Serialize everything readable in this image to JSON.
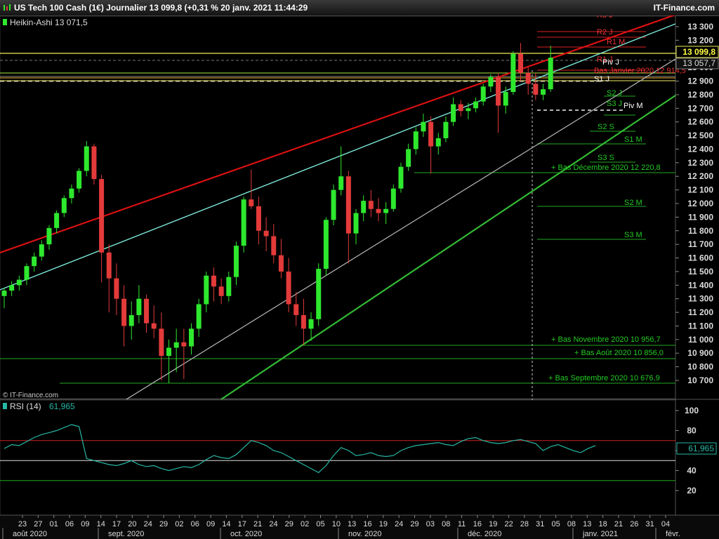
{
  "header": {
    "title": "US Tech 100 Cash (1€) Journalier 13 099,8 (+0,31 % 20 janv. 2021 11:44:29",
    "brand": "IT-Finance.com"
  },
  "legend": {
    "main": "Heikin-Ashi 13 071,5",
    "rsi_label": "RSI (14)",
    "rsi_value": "61,965"
  },
  "watermark": "© IT-Finance.com",
  "price_badges": {
    "last": "13 099,8",
    "second": "13 057,7",
    "rsi": "61,965"
  },
  "level_labels": {
    "r3j": "R3 J",
    "r2j": "R2 J",
    "r1m": "R1 M",
    "r1j": "R1 J",
    "pivj": "Piv J",
    "bas_jan": "Bas Janvier 2020 12 914,5",
    "s1j": "S1 J",
    "s2j": "S2 J",
    "s3j": "S3 J",
    "pivm": "Piv M",
    "s2s": "S2 S",
    "s1m": "S1 M",
    "s3s": "S3 S",
    "bas_dec": "+ Bas Décembre 2020 12 220,8",
    "s2m": "S2 M",
    "s3m": "S3 M",
    "bas_nov": "+ Bas Novembre 2020 10 956,7",
    "bas_aout": "+ Bas Août 2020 10 856,0",
    "bas_sept": "+ Bas Septembre 2020 10 676,9"
  },
  "colors": {
    "up": "#2ee82e",
    "down": "#e33a3a",
    "rsi_line": "#26b8a4",
    "red_trend": "#dd1111",
    "cyan_trend": "#7de8d8",
    "green_trend": "#33bb33",
    "white_trend": "#bbbbbb",
    "yellow": "#eeee55"
  },
  "chart_data": [
    {
      "type": "candlestick",
      "style": "Heikin-Ashi",
      "instrument": "US Tech 100 Cash (1€)",
      "period": "Journalier",
      "ylim": [
        10600,
        13400
      ],
      "y_ticks": [
        10700,
        10800,
        10900,
        11000,
        11100,
        11200,
        11300,
        11400,
        11500,
        11600,
        11700,
        11800,
        11900,
        12000,
        12100,
        12200,
        12300,
        12400,
        12500,
        12600,
        12700,
        12800,
        12900,
        13000,
        13100,
        13200,
        13300
      ],
      "y_tick_labels": [
        "10 700",
        "10 800",
        "10 900",
        "11 000",
        "11 100",
        "11 200",
        "11 300",
        "11 400",
        "11 500",
        "11 600",
        "11 700",
        "11 800",
        "11 900",
        "12 000",
        "12 100",
        "12 200",
        "12 300",
        "12 400",
        "12 500",
        "12 600",
        "12 700",
        "12 800",
        "12 900",
        "13 000",
        "13 100",
        "13 200",
        "13 300"
      ],
      "x_day_ticks": [
        "23",
        "27",
        "01",
        "06",
        "09",
        "14",
        "17",
        "20",
        "24",
        "29",
        "02",
        "06",
        "09",
        "14",
        "17",
        "21",
        "24",
        "29",
        "02",
        "05",
        "10",
        "13",
        "16",
        "19",
        "24",
        "29",
        "03",
        "08",
        "11",
        "16",
        "19",
        "22",
        "28",
        "31",
        "05",
        "08",
        "13",
        "18",
        "21",
        "26",
        "31",
        "04"
      ],
      "x_month_labels": [
        "août 2020",
        "sept. 2020",
        "oct. 2020",
        "nov. 2020",
        "déc. 2020",
        "janv. 2021",
        "févr."
      ],
      "candles": [
        {
          "o": 11320,
          "h": 11380,
          "l": 11230,
          "c": 11360
        },
        {
          "o": 11360,
          "h": 11430,
          "l": 11320,
          "c": 11400
        },
        {
          "o": 11400,
          "h": 11470,
          "l": 11360,
          "c": 11440
        },
        {
          "o": 11440,
          "h": 11560,
          "l": 11400,
          "c": 11540
        },
        {
          "o": 11540,
          "h": 11640,
          "l": 11500,
          "c": 11610
        },
        {
          "o": 11610,
          "h": 11730,
          "l": 11580,
          "c": 11700
        },
        {
          "o": 11700,
          "h": 11840,
          "l": 11660,
          "c": 11820
        },
        {
          "o": 11820,
          "h": 11950,
          "l": 11780,
          "c": 11930
        },
        {
          "o": 11930,
          "h": 12060,
          "l": 11900,
          "c": 12040
        },
        {
          "o": 12040,
          "h": 12140,
          "l": 12000,
          "c": 12110
        },
        {
          "o": 12110,
          "h": 12260,
          "l": 12080,
          "c": 12240
        },
        {
          "o": 12240,
          "h": 12460,
          "l": 12200,
          "c": 12420
        },
        {
          "o": 12420,
          "h": 12440,
          "l": 12140,
          "c": 12180
        },
        {
          "o": 12180,
          "h": 12210,
          "l": 11420,
          "c": 11640
        },
        {
          "o": 11640,
          "h": 11700,
          "l": 11200,
          "c": 11450
        },
        {
          "o": 11450,
          "h": 11560,
          "l": 11180,
          "c": 11300
        },
        {
          "o": 11300,
          "h": 11400,
          "l": 10950,
          "c": 11100
        },
        {
          "o": 11100,
          "h": 11280,
          "l": 11000,
          "c": 11180
        },
        {
          "o": 11180,
          "h": 11400,
          "l": 11120,
          "c": 11300
        },
        {
          "o": 11300,
          "h": 11330,
          "l": 11050,
          "c": 11120
        },
        {
          "o": 11120,
          "h": 11250,
          "l": 11010,
          "c": 11080
        },
        {
          "o": 11080,
          "h": 11200,
          "l": 10700,
          "c": 10880
        },
        {
          "o": 10880,
          "h": 11000,
          "l": 10680,
          "c": 10940
        },
        {
          "o": 10940,
          "h": 11080,
          "l": 10760,
          "c": 10980
        },
        {
          "o": 10980,
          "h": 11080,
          "l": 10710,
          "c": 10950
        },
        {
          "o": 10950,
          "h": 11120,
          "l": 10890,
          "c": 11080
        },
        {
          "o": 11080,
          "h": 11300,
          "l": 11020,
          "c": 11260
        },
        {
          "o": 11260,
          "h": 11500,
          "l": 11200,
          "c": 11470
        },
        {
          "o": 11470,
          "h": 11530,
          "l": 11280,
          "c": 11390
        },
        {
          "o": 11390,
          "h": 11450,
          "l": 11260,
          "c": 11320
        },
        {
          "o": 11320,
          "h": 11500,
          "l": 11280,
          "c": 11460
        },
        {
          "o": 11460,
          "h": 11720,
          "l": 11400,
          "c": 11690
        },
        {
          "o": 11690,
          "h": 12050,
          "l": 11640,
          "c": 12030
        },
        {
          "o": 12030,
          "h": 12250,
          "l": 11960,
          "c": 11980
        },
        {
          "o": 11980,
          "h": 12050,
          "l": 11700,
          "c": 11800
        },
        {
          "o": 11800,
          "h": 11900,
          "l": 11650,
          "c": 11760
        },
        {
          "o": 11760,
          "h": 11850,
          "l": 11560,
          "c": 11620
        },
        {
          "o": 11620,
          "h": 11740,
          "l": 11450,
          "c": 11500
        },
        {
          "o": 11500,
          "h": 11600,
          "l": 11200,
          "c": 11260
        },
        {
          "o": 11260,
          "h": 11350,
          "l": 11100,
          "c": 11180
        },
        {
          "o": 11180,
          "h": 11300,
          "l": 10960,
          "c": 11080
        },
        {
          "o": 11080,
          "h": 11200,
          "l": 10990,
          "c": 11150
        },
        {
          "o": 11150,
          "h": 11560,
          "l": 11100,
          "c": 11520
        },
        {
          "o": 11520,
          "h": 11900,
          "l": 11470,
          "c": 11880
        },
        {
          "o": 11880,
          "h": 12140,
          "l": 11840,
          "c": 12100
        },
        {
          "o": 12100,
          "h": 12420,
          "l": 12060,
          "c": 12200
        },
        {
          "o": 12200,
          "h": 12240,
          "l": 11560,
          "c": 11780
        },
        {
          "o": 11780,
          "h": 11960,
          "l": 11700,
          "c": 11930
        },
        {
          "o": 11930,
          "h": 12060,
          "l": 11870,
          "c": 12020
        },
        {
          "o": 12020,
          "h": 12100,
          "l": 11900,
          "c": 11960
        },
        {
          "o": 11960,
          "h": 12040,
          "l": 11870,
          "c": 11930
        },
        {
          "o": 11930,
          "h": 12010,
          "l": 11850,
          "c": 11960
        },
        {
          "o": 11960,
          "h": 12140,
          "l": 11940,
          "c": 12110
        },
        {
          "o": 12110,
          "h": 12300,
          "l": 12080,
          "c": 12270
        },
        {
          "o": 12270,
          "h": 12440,
          "l": 12240,
          "c": 12400
        },
        {
          "o": 12400,
          "h": 12560,
          "l": 12360,
          "c": 12530
        },
        {
          "o": 12530,
          "h": 12660,
          "l": 12490,
          "c": 12600
        },
        {
          "o": 12600,
          "h": 12640,
          "l": 12220,
          "c": 12420
        },
        {
          "o": 12420,
          "h": 12520,
          "l": 12360,
          "c": 12480
        },
        {
          "o": 12480,
          "h": 12640,
          "l": 12450,
          "c": 12600
        },
        {
          "o": 12600,
          "h": 12780,
          "l": 12570,
          "c": 12730
        },
        {
          "o": 12730,
          "h": 12760,
          "l": 12640,
          "c": 12680
        },
        {
          "o": 12680,
          "h": 12740,
          "l": 12620,
          "c": 12700
        },
        {
          "o": 12700,
          "h": 12780,
          "l": 12670,
          "c": 12750
        },
        {
          "o": 12750,
          "h": 12880,
          "l": 12720,
          "c": 12860
        },
        {
          "o": 12860,
          "h": 12950,
          "l": 12820,
          "c": 12930
        },
        {
          "o": 12930,
          "h": 12960,
          "l": 12520,
          "c": 12720
        },
        {
          "o": 12720,
          "h": 12860,
          "l": 12660,
          "c": 12820
        },
        {
          "o": 12820,
          "h": 13120,
          "l": 12800,
          "c": 13100
        },
        {
          "o": 13100,
          "h": 13180,
          "l": 12900,
          "c": 12960
        },
        {
          "o": 12960,
          "h": 13000,
          "l": 12800,
          "c": 12880
        },
        {
          "o": 12880,
          "h": 12960,
          "l": 12760,
          "c": 12800
        },
        {
          "o": 12800,
          "h": 12880,
          "l": 12760,
          "c": 12840
        },
        {
          "o": 12840,
          "h": 13160,
          "l": 12820,
          "c": 13072
        }
      ]
    },
    {
      "type": "line",
      "name": "RSI (14)",
      "ylim": [
        0,
        110
      ],
      "y_ticks": [
        20,
        40,
        60,
        80,
        100
      ],
      "levels": [
        70,
        50,
        30
      ],
      "values": [
        62,
        66,
        65,
        69,
        73,
        76,
        78,
        80,
        83,
        86,
        84,
        52,
        50,
        48,
        46,
        45,
        47,
        50,
        46,
        44,
        45,
        42,
        40,
        42,
        44,
        43,
        46,
        51,
        55,
        53,
        52,
        56,
        63,
        70,
        68,
        65,
        60,
        58,
        54,
        50,
        46,
        42,
        38,
        45,
        55,
        63,
        60,
        55,
        56,
        58,
        55,
        54,
        55,
        60,
        63,
        65,
        66,
        67,
        68,
        66,
        65,
        69,
        72,
        73,
        70,
        68,
        67,
        68,
        70,
        71,
        69,
        67,
        60,
        64,
        66,
        63,
        60,
        58,
        62,
        65
      ]
    }
  ]
}
